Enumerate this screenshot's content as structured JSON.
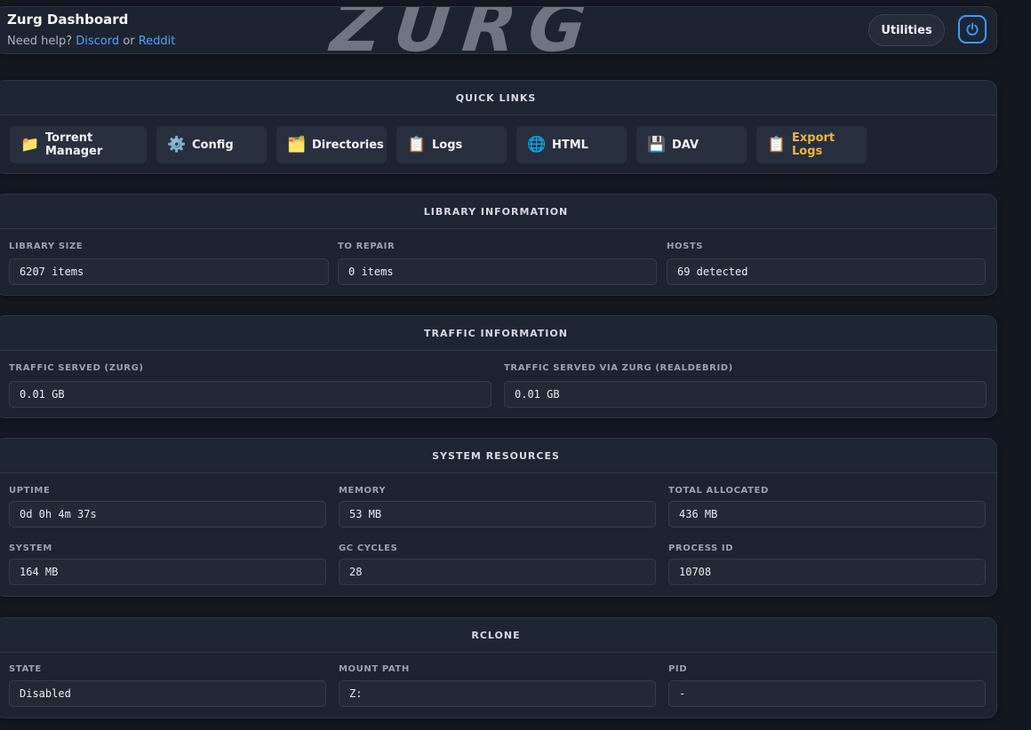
{
  "header": {
    "title": "Zurg Dashboard",
    "help_prefix": "Need help?",
    "discord": "Discord",
    "or": "or",
    "reddit": "Reddit",
    "watermark": "ZURG",
    "utilities_label": "Utilities",
    "power_icon": "power-icon"
  },
  "quick_links": {
    "title": "QUICK LINKS",
    "items": [
      {
        "label": "Torrent Manager",
        "icon": "📁"
      },
      {
        "label": "Config",
        "icon": "⚙️"
      },
      {
        "label": "Directories",
        "icon": "🗂️"
      },
      {
        "label": "Logs",
        "icon": "📋"
      },
      {
        "label": "HTML",
        "icon": "🌐"
      },
      {
        "label": "DAV",
        "icon": "💾"
      },
      {
        "label": "Export Logs",
        "icon": "📋"
      }
    ]
  },
  "library": {
    "title": "LIBRARY INFORMATION",
    "fields": [
      {
        "label": "LIBRARY SIZE",
        "value": "6207 items"
      },
      {
        "label": "TO REPAIR",
        "value": "0 items"
      },
      {
        "label": "HOSTS",
        "value": "69 detected"
      }
    ]
  },
  "traffic": {
    "title": "TRAFFIC INFORMATION",
    "fields": [
      {
        "label": "TRAFFIC SERVED (ZURG)",
        "value": "0.01 GB"
      },
      {
        "label": "TRAFFIC SERVED VIA ZURG (REALDEBRID)",
        "value": "0.01 GB"
      }
    ]
  },
  "system": {
    "title": "SYSTEM RESOURCES",
    "fields": [
      {
        "label": "UPTIME",
        "value": "0d 0h 4m 37s"
      },
      {
        "label": "MEMORY",
        "value": "53 MB"
      },
      {
        "label": "TOTAL ALLOCATED",
        "value": "436 MB"
      },
      {
        "label": "SYSTEM",
        "value": "164 MB"
      },
      {
        "label": "GC CYCLES",
        "value": "28"
      },
      {
        "label": "PROCESS ID",
        "value": "10708"
      }
    ]
  },
  "rclone": {
    "title": "RCLONE",
    "fields": [
      {
        "label": "STATE",
        "value": "Disabled"
      },
      {
        "label": "MOUNT PATH",
        "value": "Z:"
      },
      {
        "label": "PID",
        "value": "-"
      }
    ]
  },
  "colors": {
    "background": "#141821",
    "card": "#1d2330",
    "link": "#4fa3ff",
    "accent": "#f2b43a",
    "power": "#3b9cff"
  }
}
